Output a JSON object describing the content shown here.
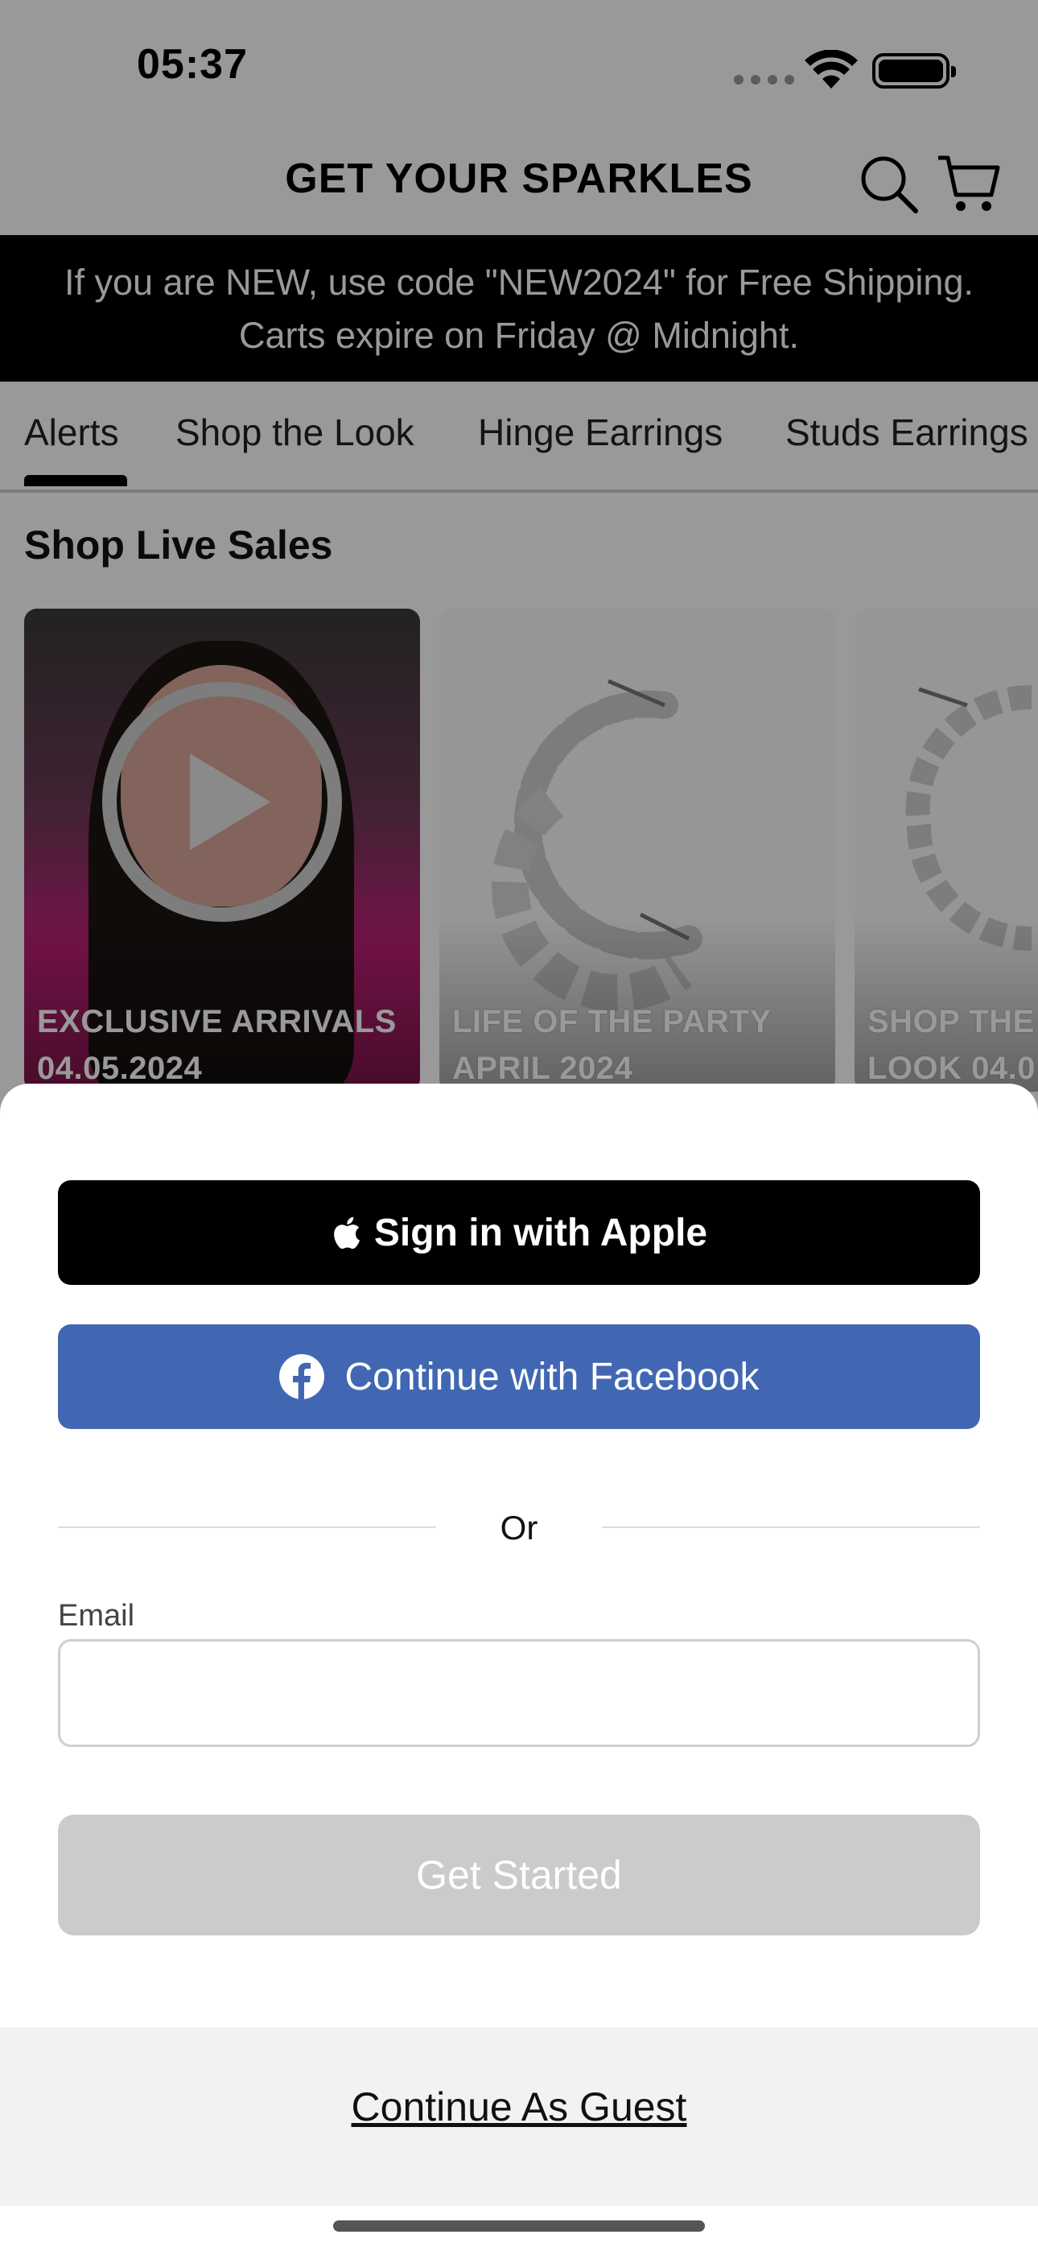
{
  "status_bar": {
    "time": "05:37"
  },
  "header": {
    "title": "GET YOUR SPARKLES",
    "search_icon": "search-icon",
    "cart_icon": "cart-icon"
  },
  "promo": {
    "line1": "If you are NEW, use code \"NEW2024\" for Free Shipping.",
    "line2": "Carts expire on Friday @ Midnight."
  },
  "tabs": [
    {
      "label": "Alerts",
      "active": true
    },
    {
      "label": "Shop the Look"
    },
    {
      "label": "Hinge Earrings"
    },
    {
      "label": "Studs Earrings"
    }
  ],
  "section": {
    "title": "Shop Live Sales"
  },
  "cards": [
    {
      "line1": "EXCLUSIVE ARRIVALS",
      "line2": "04.05.2024"
    },
    {
      "line1": "LIFE OF THE PARTY",
      "line2": "APRIL 2024"
    },
    {
      "line1": "SHOP THE",
      "line2": "LOOK 04.0"
    }
  ],
  "auth": {
    "apple_label": "Sign in with Apple",
    "facebook_label": "Continue with Facebook",
    "or_label": "Or",
    "email_label": "Email",
    "email_value": "",
    "get_started_label": "Get Started",
    "guest_label": "Continue As Guest"
  },
  "colors": {
    "facebook": "#4267b2",
    "disabled_button": "#cbcbcb",
    "promo_bg": "#000000"
  }
}
